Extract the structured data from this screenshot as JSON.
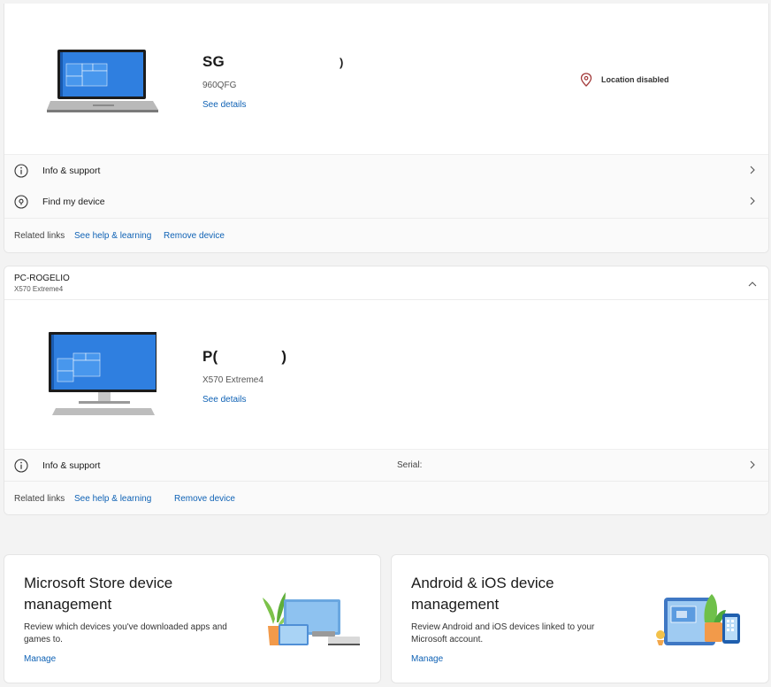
{
  "device1": {
    "name_visible": "SG",
    "name_tail": ")",
    "model": "960QFG",
    "see_details": "See details",
    "location": "Location disabled",
    "rows": [
      {
        "label": "Info & support"
      },
      {
        "label": "Find my device"
      }
    ],
    "related_label": "Related links",
    "related_links": [
      "See help & learning",
      "Remove device"
    ]
  },
  "device2": {
    "header_title": "PC-ROGELIO",
    "header_sub": "X570 Extreme4",
    "name_visible": "P(",
    "name_tail": ")",
    "model": "X570 Extreme4",
    "see_details": "See details",
    "rows": [
      {
        "label": "Info & support",
        "serial_label": "Serial:"
      }
    ],
    "related_label": "Related links",
    "related_links": [
      "See help & learning",
      "Remove device"
    ]
  },
  "promos": [
    {
      "title": "Microsoft Store device management",
      "desc": "Review which devices you've downloaded apps and games to.",
      "link": "Manage"
    },
    {
      "title": "Android & iOS device management",
      "desc": "Review Android and iOS devices linked to your Microsoft account.",
      "link": "Manage"
    }
  ],
  "icons": {
    "info": "info-icon",
    "location": "location-pin-icon",
    "chevron_right": "chevron-right-icon",
    "chevron_up": "chevron-up-icon"
  },
  "colors": {
    "accent": "#0f62b5",
    "location_pin": "#a33b3b",
    "screen_blue": "#1f6fd1"
  }
}
